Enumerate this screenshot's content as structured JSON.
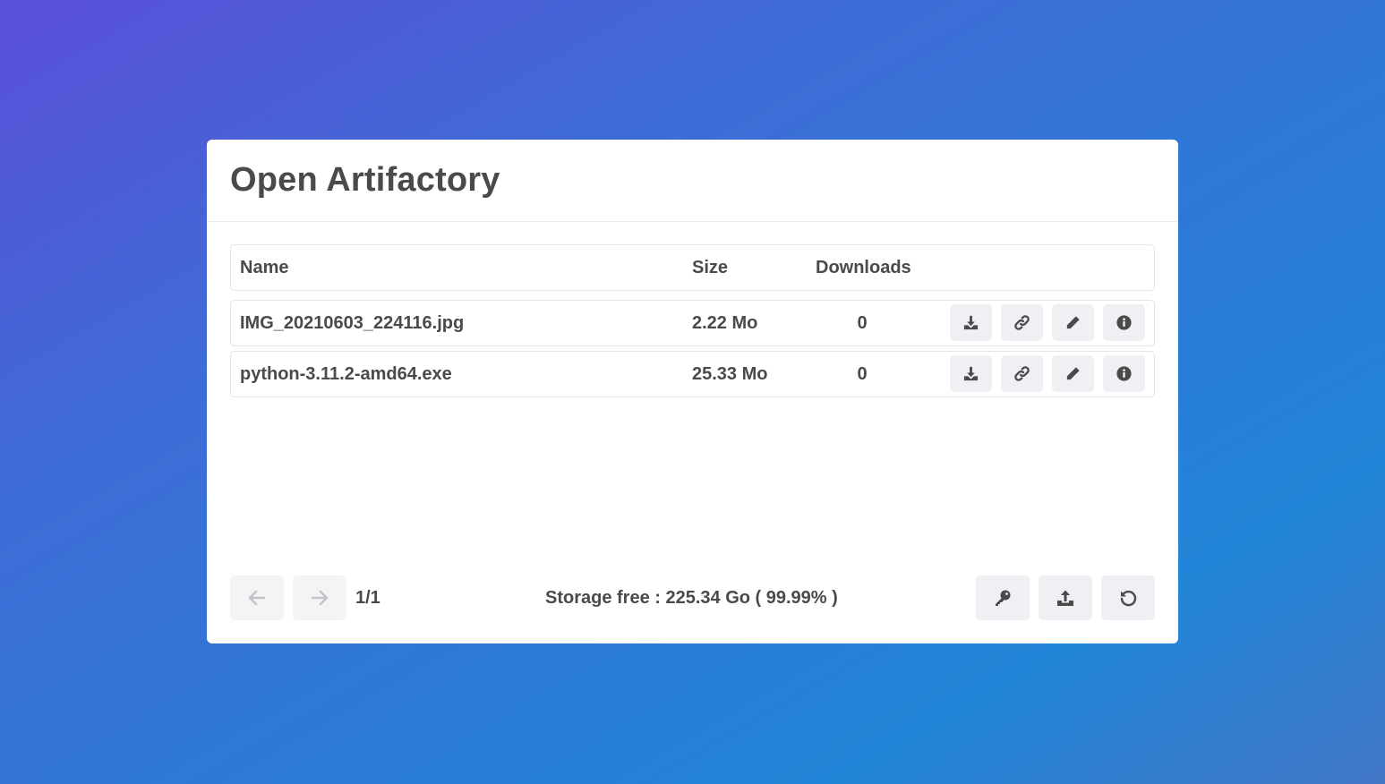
{
  "app": {
    "title": "Open Artifactory"
  },
  "table": {
    "headers": {
      "name": "Name",
      "size": "Size",
      "downloads": "Downloads"
    },
    "rows": [
      {
        "name": "IMG_20210603_224116.jpg",
        "size": "2.22 Mo",
        "downloads": "0"
      },
      {
        "name": "python-3.11.2-amd64.exe",
        "size": "25.33 Mo",
        "downloads": "0"
      }
    ],
    "row_actions": [
      "download-icon",
      "link-icon",
      "pencil-icon",
      "info-icon"
    ]
  },
  "footer": {
    "page_indicator": "1/1",
    "storage_text": "Storage free : 225.34 Go ( 99.99% )",
    "prev_icon": "arrow-left-icon",
    "next_icon": "arrow-right-icon",
    "actions": [
      "key-icon",
      "upload-icon",
      "refresh-icon"
    ]
  },
  "colors": {
    "text": "#4a4a4a",
    "button_bg": "#eef0f4",
    "disabled_icon": "#c3c4c7",
    "gradient_start": "#5a4fd8",
    "gradient_end": "#2285d8"
  }
}
